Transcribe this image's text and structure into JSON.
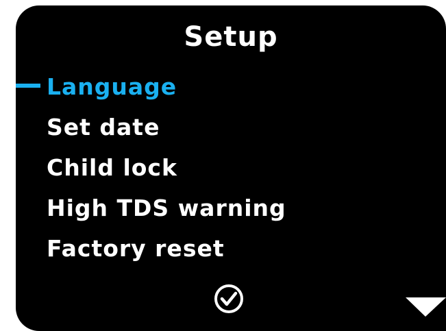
{
  "screen": {
    "title": "Setup"
  },
  "menu": {
    "items": [
      {
        "label": "Language",
        "selected": true
      },
      {
        "label": "Set date",
        "selected": false
      },
      {
        "label": "Child lock",
        "selected": false
      },
      {
        "label": "High TDS warning",
        "selected": false
      },
      {
        "label": "Factory reset",
        "selected": false
      }
    ]
  },
  "controls": {
    "confirm_icon": "check-circle-icon",
    "scroll_icon": "triangle-down-icon"
  },
  "colors": {
    "background": "#000000",
    "text": "#ffffff",
    "accent": "#1ab0f0"
  }
}
